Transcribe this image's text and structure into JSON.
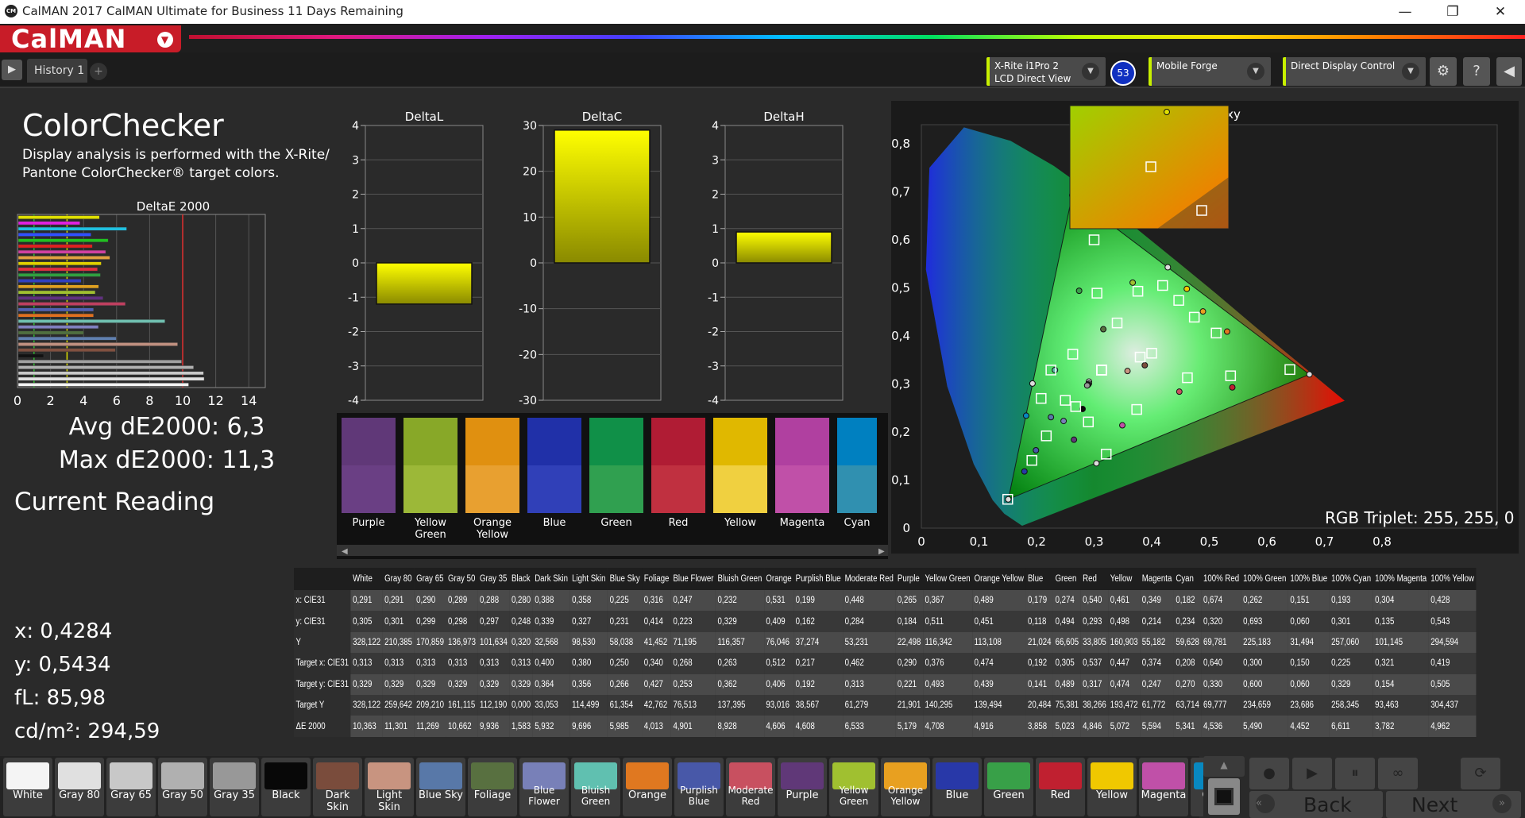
{
  "window": {
    "title": "CalMAN 2017 CalMAN Ultimate for Business 11 Days Remaining",
    "app_icon": "CM"
  },
  "brand": {
    "logo": "CalMAN"
  },
  "tabs": {
    "history": "History 1",
    "add": "+"
  },
  "devices": [
    {
      "line1": "X-Rite i1Pro 2",
      "line2": "LCD Direct View"
    },
    {
      "line1": "Mobile Forge",
      "line2": ""
    },
    {
      "line1": "Direct Display Control",
      "line2": ""
    }
  ],
  "badge": "53",
  "page": {
    "title": "ColorChecker",
    "description": "Display analysis is performed with the X-Rite/ Pantone ColorChecker® target colors."
  },
  "summary": {
    "avg": "Avg dE2000: 6,3",
    "max": "Max dE2000: 11,3"
  },
  "reading": {
    "heading": "Current Reading",
    "x": "x: 0,4284",
    "y": "y: 0,5434",
    "fl": "fL: 85,98",
    "cdm": "cd/m²: 294,59"
  },
  "deltaE_chart": {
    "title": "DeltaE 2000",
    "ticks": [
      "0",
      "2",
      "4",
      "6",
      "8",
      "10",
      "12",
      "14"
    ],
    "xmax": 15,
    "thresholds": [
      1,
      3,
      10
    ],
    "bars": [
      {
        "v": 4.962,
        "c": "#e0e000"
      },
      {
        "v": 3.782,
        "c": "#e020e0"
      },
      {
        "v": 6.611,
        "c": "#20c0e0"
      },
      {
        "v": 4.452,
        "c": "#3050ff"
      },
      {
        "v": 5.49,
        "c": "#20c020"
      },
      {
        "v": 4.536,
        "c": "#e02020"
      },
      {
        "v": 5.341,
        "c": "#d040a0"
      },
      {
        "v": 5.594,
        "c": "#e0a040"
      },
      {
        "v": 5.072,
        "c": "#e0d000"
      },
      {
        "v": 4.846,
        "c": "#e03040"
      },
      {
        "v": 5.023,
        "c": "#30a040"
      },
      {
        "v": 3.858,
        "c": "#3040c0"
      },
      {
        "v": 4.916,
        "c": "#e0a020"
      },
      {
        "v": 4.708,
        "c": "#a0c030"
      },
      {
        "v": 5.179,
        "c": "#603080"
      },
      {
        "v": 6.533,
        "c": "#c04060"
      },
      {
        "v": 4.608,
        "c": "#5060b0"
      },
      {
        "v": 4.606,
        "c": "#e07020"
      },
      {
        "v": 8.928,
        "c": "#70c0b0"
      },
      {
        "v": 4.901,
        "c": "#8080c0"
      },
      {
        "v": 4.013,
        "c": "#507040"
      },
      {
        "v": 5.985,
        "c": "#6080b0"
      },
      {
        "v": 9.696,
        "c": "#c09080"
      },
      {
        "v": 5.932,
        "c": "#805040"
      },
      {
        "v": 1.583,
        "c": "#111111"
      },
      {
        "v": 9.936,
        "c": "#a0a0a0"
      },
      {
        "v": 10.662,
        "c": "#b0b0b0"
      },
      {
        "v": 11.269,
        "c": "#c8c8c8"
      },
      {
        "v": 11.301,
        "c": "#e0e0e0"
      },
      {
        "v": 10.363,
        "c": "#f4f4f4"
      }
    ]
  },
  "graphs": [
    {
      "title": "DeltaL",
      "ticks": [
        "4",
        "3",
        "2",
        "1",
        "0",
        "-1",
        "-2",
        "-3",
        "-4"
      ],
      "min": -4,
      "max": 4,
      "value": -1.2
    },
    {
      "title": "DeltaC",
      "ticks": [
        "30",
        "20",
        "10",
        "0",
        "-10",
        "-20",
        "-30"
      ],
      "min": -30,
      "max": 30,
      "value": 29
    },
    {
      "title": "DeltaH",
      "ticks": [
        "4",
        "3",
        "2",
        "1",
        "0",
        "-1",
        "-2",
        "-3",
        "-4"
      ],
      "min": -4,
      "max": 4,
      "value": 0.9
    }
  ],
  "patch_strip": [
    {
      "label": "Purple",
      "top": "#603878",
      "bottom": "#6a3f84"
    },
    {
      "label": "Yellow Green",
      "top": "#88a828",
      "bottom": "#9cb838"
    },
    {
      "label": "Orange Yellow",
      "top": "#e09010",
      "bottom": "#e8a030"
    },
    {
      "label": "Blue",
      "top": "#2030a8",
      "bottom": "#3040b8"
    },
    {
      "label": "Green",
      "top": "#109048",
      "bottom": "#30a050"
    },
    {
      "label": "Red",
      "top": "#b01c34",
      "bottom": "#c03040"
    },
    {
      "label": "Yellow",
      "top": "#e0b800",
      "bottom": "#f0d040"
    },
    {
      "label": "Magenta",
      "top": "#b040a0",
      "bottom": "#c050a8"
    },
    {
      "label": "Cyan",
      "top": "#0080c0",
      "bottom": "#3090b0"
    }
  ],
  "cie": {
    "title": "CIE 1931 xy",
    "rgb_triplet": "RGB Triplet: 255, 255, 0",
    "xticks": [
      "0",
      "0,1",
      "0,2",
      "0,3",
      "0,4",
      "0,5",
      "0,6",
      "0,7",
      "0,8"
    ],
    "yticks": [
      "0,8",
      "0,7",
      "0,6",
      "0,5",
      "0,4",
      "0,3",
      "0,2",
      "0,1",
      "0"
    ]
  },
  "table": {
    "columns": [
      "White",
      "Gray 80",
      "Gray 65",
      "Gray 50",
      "Gray 35",
      "Black",
      "Dark Skin",
      "Light Skin",
      "Blue Sky",
      "Foliage",
      "Blue Flower",
      "Bluish Green",
      "Orange",
      "Purplish Blue",
      "Moderate Red",
      "Purple",
      "Yellow Green",
      "Orange Yellow",
      "Blue",
      "Green",
      "Red",
      "Yellow",
      "Magenta",
      "Cyan",
      "100% Red",
      "100% Green",
      "100% Blue",
      "100% Cyan",
      "100% Magenta",
      "100% Yellow"
    ],
    "rows": [
      {
        "label": "x: CIE31",
        "values": [
          "0,291",
          "0,291",
          "0,290",
          "0,289",
          "0,288",
          "0,280",
          "0,388",
          "0,358",
          "0,225",
          "0,316",
          "0,247",
          "0,232",
          "0,531",
          "0,199",
          "0,448",
          "0,265",
          "0,367",
          "0,489",
          "0,179",
          "0,274",
          "0,540",
          "0,461",
          "0,349",
          "0,182",
          "0,674",
          "0,262",
          "0,151",
          "0,193",
          "0,304",
          "0,428"
        ]
      },
      {
        "label": "y: CIE31",
        "values": [
          "0,305",
          "0,301",
          "0,299",
          "0,298",
          "0,297",
          "0,248",
          "0,339",
          "0,327",
          "0,231",
          "0,414",
          "0,223",
          "0,329",
          "0,409",
          "0,162",
          "0,284",
          "0,184",
          "0,511",
          "0,451",
          "0,118",
          "0,494",
          "0,293",
          "0,498",
          "0,214",
          "0,234",
          "0,320",
          "0,693",
          "0,060",
          "0,301",
          "0,135",
          "0,543"
        ]
      },
      {
        "label": "Y",
        "values": [
          "328,122",
          "210,385",
          "170,859",
          "136,973",
          "101,634",
          "0,320",
          "32,568",
          "98,530",
          "58,038",
          "41,452",
          "71,195",
          "116,357",
          "76,046",
          "37,274",
          "53,231",
          "22,498",
          "116,342",
          "113,108",
          "21,024",
          "66,605",
          "33,805",
          "160,903",
          "55,182",
          "59,628",
          "69,781",
          "225,183",
          "31,494",
          "257,060",
          "101,145",
          "294,594"
        ]
      },
      {
        "label": "Target x: CIE31",
        "values": [
          "0,313",
          "0,313",
          "0,313",
          "0,313",
          "0,313",
          "0,313",
          "0,400",
          "0,380",
          "0,250",
          "0,340",
          "0,268",
          "0,263",
          "0,512",
          "0,217",
          "0,462",
          "0,290",
          "0,376",
          "0,474",
          "0,192",
          "0,305",
          "0,537",
          "0,447",
          "0,374",
          "0,208",
          "0,640",
          "0,300",
          "0,150",
          "0,225",
          "0,321",
          "0,419"
        ]
      },
      {
        "label": "Target y: CIE31",
        "values": [
          "0,329",
          "0,329",
          "0,329",
          "0,329",
          "0,329",
          "0,329",
          "0,364",
          "0,356",
          "0,266",
          "0,427",
          "0,253",
          "0,362",
          "0,406",
          "0,192",
          "0,313",
          "0,221",
          "0,493",
          "0,439",
          "0,141",
          "0,489",
          "0,317",
          "0,474",
          "0,247",
          "0,270",
          "0,330",
          "0,600",
          "0,060",
          "0,329",
          "0,154",
          "0,505"
        ]
      },
      {
        "label": "Target Y",
        "values": [
          "328,122",
          "259,642",
          "209,210",
          "161,115",
          "112,190",
          "0,000",
          "33,053",
          "114,499",
          "61,354",
          "42,762",
          "76,513",
          "137,395",
          "93,016",
          "38,567",
          "61,279",
          "21,901",
          "140,295",
          "139,494",
          "20,484",
          "75,381",
          "38,266",
          "193,472",
          "61,772",
          "63,714",
          "69,777",
          "234,659",
          "23,686",
          "258,345",
          "93,463",
          "304,437"
        ]
      },
      {
        "label": "ΔE 2000",
        "values": [
          "10,363",
          "11,301",
          "11,269",
          "10,662",
          "9,936",
          "1,583",
          "5,932",
          "9,696",
          "5,985",
          "4,013",
          "4,901",
          "8,928",
          "4,606",
          "4,608",
          "6,533",
          "5,179",
          "4,708",
          "4,916",
          "3,858",
          "5,023",
          "4,846",
          "5,072",
          "5,594",
          "5,341",
          "4,536",
          "5,490",
          "4,452",
          "6,611",
          "3,782",
          "4,962"
        ]
      }
    ]
  },
  "swatches": [
    {
      "label": "White",
      "color": "#f4f4f4"
    },
    {
      "label": "Gray 80",
      "color": "#e0e0e0"
    },
    {
      "label": "Gray 65",
      "color": "#c8c8c8"
    },
    {
      "label": "Gray 50",
      "color": "#b0b0b0"
    },
    {
      "label": "Gray 35",
      "color": "#989898"
    },
    {
      "label": "Black",
      "color": "#080808"
    },
    {
      "label": "Dark Skin",
      "color": "#7a4c3c"
    },
    {
      "label": "Light Skin",
      "color": "#c89480"
    },
    {
      "label": "Blue Sky",
      "color": "#5878a8"
    },
    {
      "label": "Foliage",
      "color": "#587040"
    },
    {
      "label": "Blue Flower",
      "color": "#7880b8"
    },
    {
      "label": "Bluish Green",
      "color": "#60c0b0"
    },
    {
      "label": "Orange",
      "color": "#e07820"
    },
    {
      "label": "Purplish Blue",
      "color": "#4858a8"
    },
    {
      "label": "Moderate Red",
      "color": "#c85060"
    },
    {
      "label": "Purple",
      "color": "#603878"
    },
    {
      "label": "Yellow Green",
      "color": "#a0c030"
    },
    {
      "label": "Orange Yellow",
      "color": "#e8a020"
    },
    {
      "label": "Blue",
      "color": "#2838a8"
    },
    {
      "label": "Green",
      "color": "#38a048"
    },
    {
      "label": "Red",
      "color": "#c02030"
    },
    {
      "label": "Yellow",
      "color": "#f0c800"
    },
    {
      "label": "Magenta",
      "color": "#c050a8"
    },
    {
      "label": "Cyan",
      "color": "#0888c0"
    }
  ],
  "nav": {
    "back": "Back",
    "next": "Next"
  }
}
